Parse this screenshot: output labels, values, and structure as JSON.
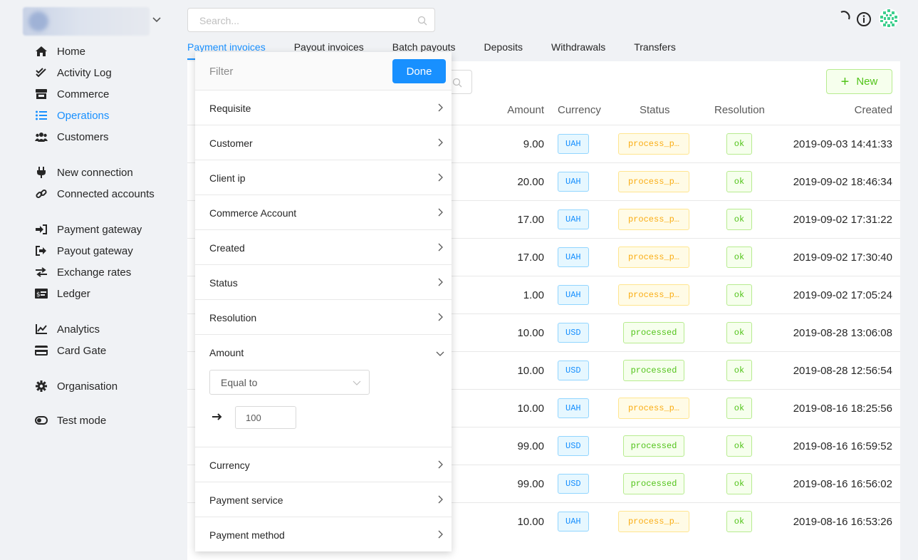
{
  "sidebar": {
    "items": [
      {
        "label": "Home",
        "icon": "home-icon"
      },
      {
        "label": "Activity Log",
        "icon": "check-double-icon"
      },
      {
        "label": "Commerce",
        "icon": "store-icon"
      },
      {
        "label": "Operations",
        "icon": "list-icon",
        "active": true
      },
      {
        "label": "Customers",
        "icon": "users-icon"
      },
      {
        "label": "New connection",
        "icon": "plug-icon"
      },
      {
        "label": "Connected accounts",
        "icon": "link-icon"
      },
      {
        "label": "Payment gateway",
        "icon": "sign-in-icon"
      },
      {
        "label": "Payout gateway",
        "icon": "sign-out-icon"
      },
      {
        "label": "Exchange rates",
        "icon": "exchange-icon"
      },
      {
        "label": "Ledger",
        "icon": "money-bill-icon"
      },
      {
        "label": "Analytics",
        "icon": "chart-line-icon"
      },
      {
        "label": "Card Gate",
        "icon": "credit-card-icon"
      },
      {
        "label": "Organisation",
        "icon": "gear-icon"
      },
      {
        "label": "Test mode",
        "icon": "toggle-icon"
      }
    ]
  },
  "search": {
    "placeholder": "Search..."
  },
  "tabs": [
    "Payment invoices",
    "Payout invoices",
    "Batch payouts",
    "Deposits",
    "Withdrawals",
    "Transfers"
  ],
  "toolbar": {
    "new_label": "New"
  },
  "table": {
    "headers": {
      "amount": "Amount",
      "currency": "Currency",
      "status": "Status",
      "resolution": "Resolution",
      "created": "Created"
    },
    "rows": [
      {
        "amount": "9.00",
        "currency": "UAH",
        "status": "process_p…",
        "resolution": "ok",
        "created": "2019-09-03 14:41:33"
      },
      {
        "amount": "20.00",
        "currency": "UAH",
        "status": "process_p…",
        "resolution": "ok",
        "created": "2019-09-02 18:46:34"
      },
      {
        "amount": "17.00",
        "currency": "UAH",
        "status": "process_p…",
        "resolution": "ok",
        "created": "2019-09-02 17:31:22"
      },
      {
        "amount": "17.00",
        "currency": "UAH",
        "status": "process_p…",
        "resolution": "ok",
        "created": "2019-09-02 17:30:40"
      },
      {
        "amount": "1.00",
        "currency": "UAH",
        "status": "process_p…",
        "resolution": "ok",
        "created": "2019-09-02 17:05:24"
      },
      {
        "amount": "10.00",
        "currency": "USD",
        "status": "processed",
        "resolution": "ok",
        "created": "2019-08-28 13:06:08"
      },
      {
        "amount": "10.00",
        "currency": "USD",
        "status": "processed",
        "resolution": "ok",
        "created": "2019-08-28 12:56:54"
      },
      {
        "amount": "10.00",
        "currency": "UAH",
        "status": "process_p…",
        "resolution": "ok",
        "created": "2019-08-16 18:25:56"
      },
      {
        "amount": "99.00",
        "currency": "USD",
        "status": "processed",
        "resolution": "ok",
        "created": "2019-08-16 16:59:52"
      },
      {
        "amount": "99.00",
        "currency": "USD",
        "status": "processed",
        "resolution": "ok",
        "created": "2019-08-16 16:56:02"
      },
      {
        "amount": "10.00",
        "currency": "UAH",
        "status": "process_p…",
        "resolution": "ok",
        "created": "2019-08-16 16:53:26"
      }
    ]
  },
  "filter": {
    "placeholder": "Filter",
    "done_label": "Done",
    "items_before": [
      "Requisite",
      "Customer",
      "Client ip",
      "Commerce Account",
      "Created",
      "Status",
      "Resolution"
    ],
    "amount_label": "Amount",
    "amount_operator": "Equal to",
    "amount_value": "100",
    "items_after": [
      "Currency",
      "Payment service",
      "Payment method"
    ]
  },
  "colors": {
    "accent": "#1890ff",
    "success": "#52c41a",
    "warning": "#faad14"
  }
}
